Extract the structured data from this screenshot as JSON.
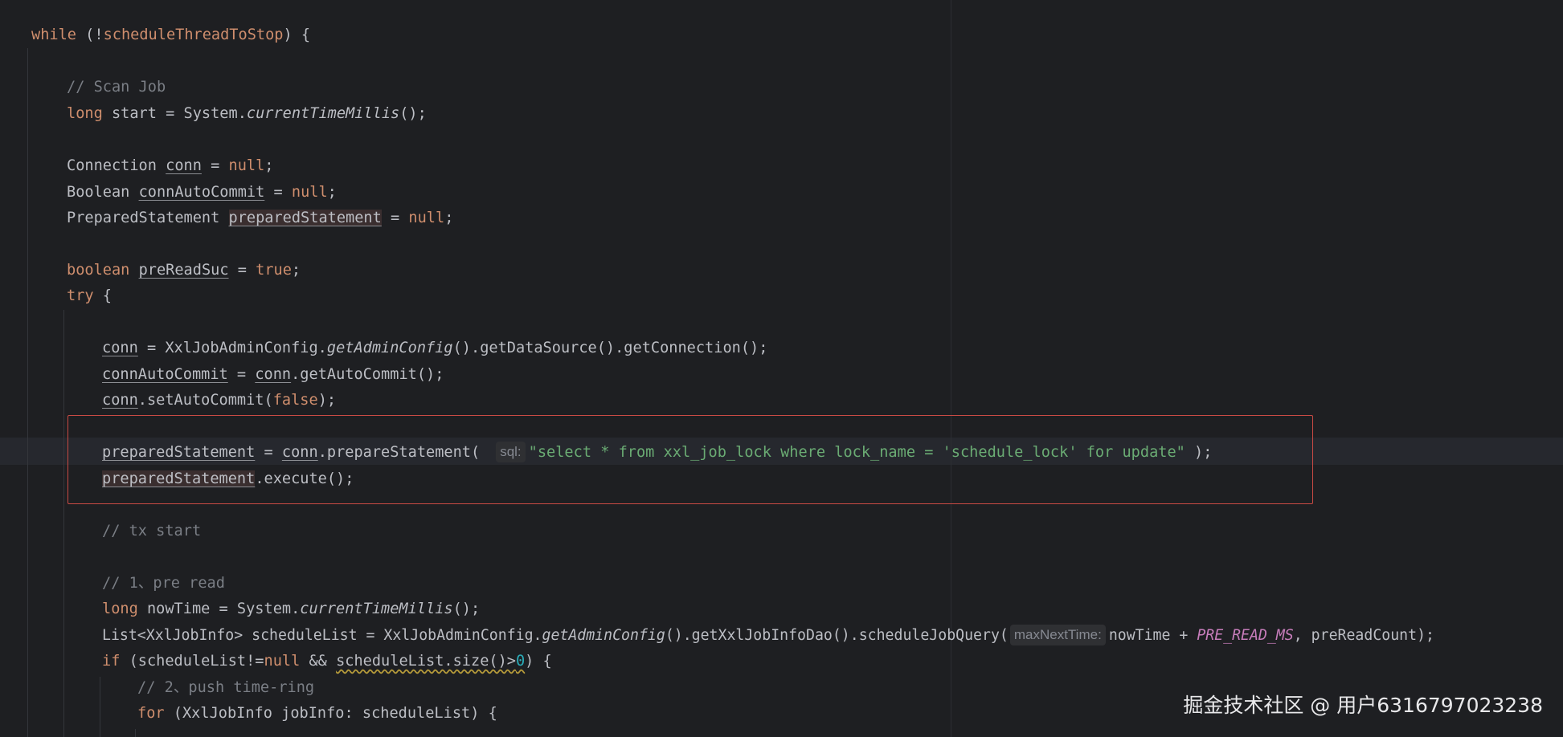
{
  "code": {
    "l1": {
      "kw": "while",
      "t1": " (!",
      "var": "scheduleThreadToStop",
      "t2": ") {"
    },
    "l2": {
      "cm": "// Scan Job"
    },
    "l3": {
      "kw": "long",
      "t1": " start = System.",
      "fn": "currentTimeMillis",
      "t2": "();"
    },
    "l4": {
      "type": "Connection ",
      "var": "conn",
      "t1": " = ",
      "kw": "null",
      "t2": ";"
    },
    "l5": {
      "type": "Boolean ",
      "var": "connAutoCommit",
      "t1": " = ",
      "kw": "null",
      "t2": ";"
    },
    "l6": {
      "type": "PreparedStatement ",
      "var": "preparedStatement",
      "t1": " = ",
      "kw": "null",
      "t2": ";"
    },
    "l7": {
      "kw": "boolean",
      "t0": " ",
      "var": "preReadSuc",
      "t1": " = ",
      "kw2": "true",
      "t2": ";"
    },
    "l8": {
      "kw": "try",
      "t1": " {"
    },
    "l9": {
      "var": "conn",
      "t1": " = XxlJobAdminConfig.",
      "fn": "getAdminConfig",
      "t2": "().getDataSource().getConnection();"
    },
    "l10": {
      "var": "connAutoCommit",
      "t1": " = ",
      "var2": "conn",
      "t2": ".getAutoCommit();"
    },
    "l11": {
      "var": "conn",
      "t1": ".setAutoCommit(",
      "kw": "false",
      "t2": ");"
    },
    "l12": {
      "var": "preparedStatement",
      "t1": " = ",
      "var2": "conn",
      "t2": ".prepareStatement(",
      "hint": "sql:",
      "str": "\"select * from xxl_job_lock where lock_name = 'schedule_lock' for update\"",
      "t3": " );"
    },
    "l13": {
      "var": "preparedStatement",
      "t1": ".execute();"
    },
    "l14": {
      "cm": "// tx start"
    },
    "l15": {
      "cm": "// 1、pre read"
    },
    "l16": {
      "kw": "long",
      "t1": " nowTime = System.",
      "fn": "currentTimeMillis",
      "t2": "();"
    },
    "l17": {
      "t1": "List<XxlJobInfo> scheduleList = XxlJobAdminConfig.",
      "fn": "getAdminConfig",
      "t2": "().getXxlJobInfoDao().scheduleJobQuery(",
      "hint": "maxNextTime:",
      "t3": "nowTime + ",
      "const": "PRE_READ_MS",
      "t4": ", preReadCount);"
    },
    "l18": {
      "kw": "if",
      "t1": " (scheduleList!=",
      "kw2": "null",
      "t2": " && ",
      "sq1": "scheduleList.size()>",
      "num": "0",
      "t3": ") {"
    },
    "l19": {
      "cm": "// 2、push time-ring"
    },
    "l20": {
      "kw": "for",
      "t1": " (XxlJobInfo jobInfo: scheduleList) {"
    }
  },
  "watermark": "掘金技术社区 @ 用户6316797023238",
  "colors": {
    "background": "#1e1f22",
    "keyword": "#cf8e6d",
    "comment": "#7a7e85",
    "string": "#6aab73",
    "number": "#2aacb8",
    "constant": "#c77dbb",
    "highlight_box": "#c94a44"
  }
}
